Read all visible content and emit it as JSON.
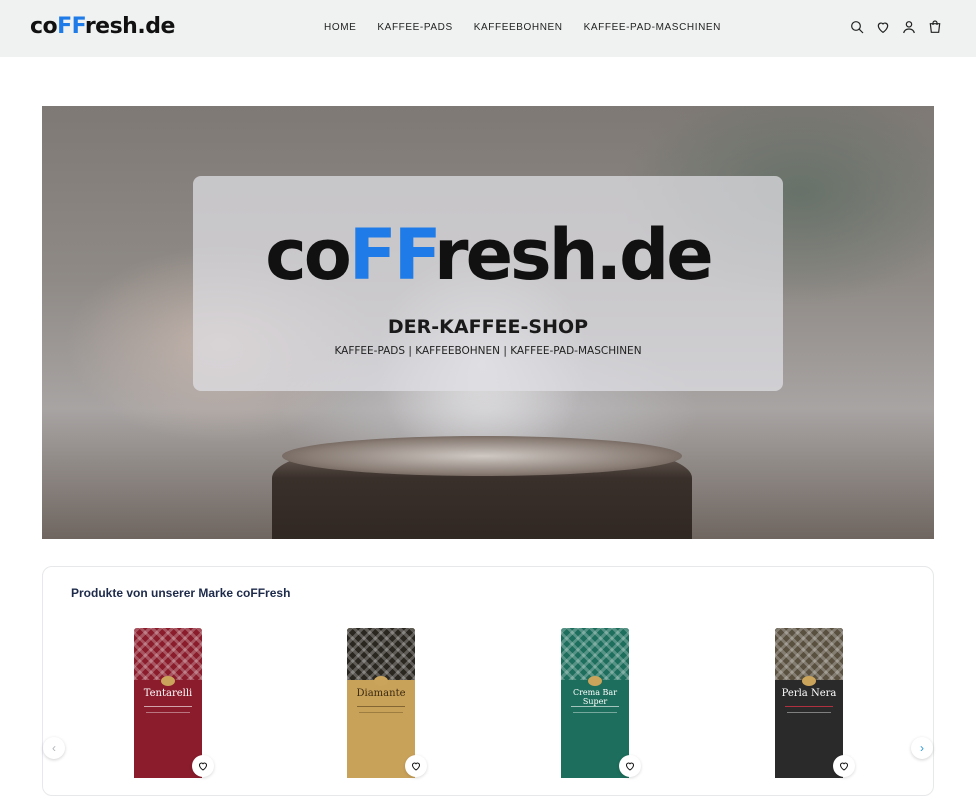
{
  "header": {
    "logo": {
      "prefix": "co",
      "highlight": "FF",
      "suffix": "resh.de"
    },
    "nav": [
      "HOME",
      "KAFFEE-PADS",
      "KAFFEEBOHNEN",
      "KAFFEE-PAD-MASCHINEN"
    ],
    "icons": [
      "search-icon",
      "heart-icon",
      "user-icon",
      "cart-icon"
    ]
  },
  "hero": {
    "logo": {
      "prefix": "co",
      "highlight": "FF",
      "suffix": "resh.de"
    },
    "subtitle": "DER-KAFFEE-SHOP",
    "categories": "KAFFEE-PADS | KAFFEEBOHNEN | KAFFEE-PAD-MASCHINEN"
  },
  "products": {
    "title": "Produkte von unserer Marke coFFresh",
    "items": [
      {
        "name": "Tentarelli",
        "color": "#8a1c2c"
      },
      {
        "name": "Diamante",
        "color": "#c9a25a"
      },
      {
        "name": "Crema Bar Super",
        "color": "#1d6e5c"
      },
      {
        "name": "Perla Nera",
        "color": "#2a2a2a"
      }
    ]
  },
  "colors": {
    "accent": "#1e7be8",
    "header_bg": "#eff2f1",
    "title": "#1d2a4a"
  }
}
